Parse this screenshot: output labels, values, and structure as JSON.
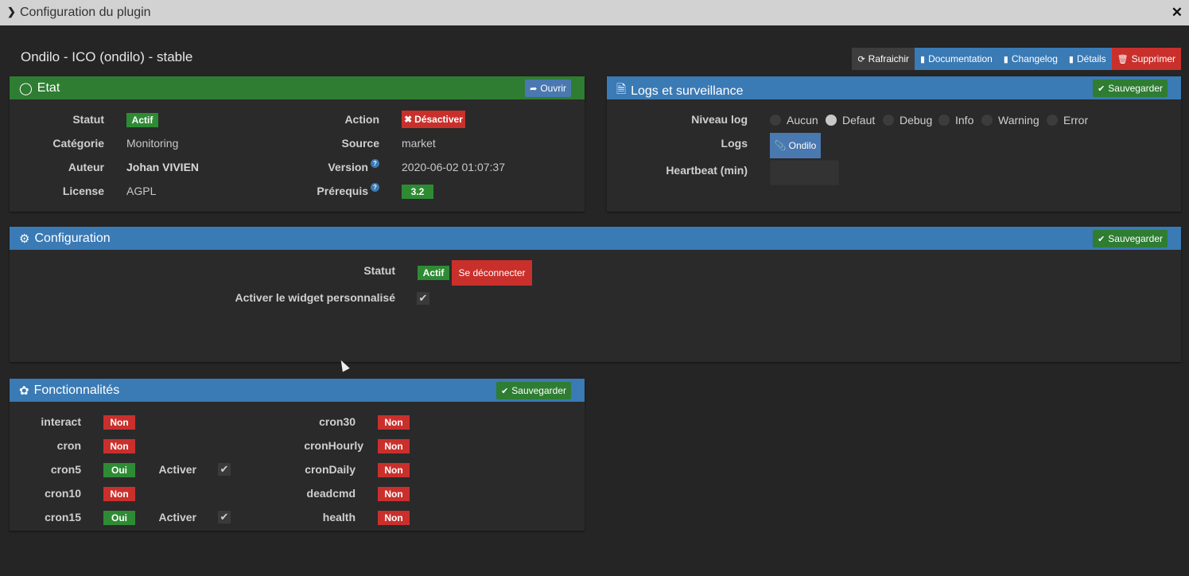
{
  "window": {
    "title": "Configuration du plugin",
    "chevron_icon": "chevron-right-icon",
    "close_icon": "close-icon"
  },
  "plugin_title": "Ondilo - ICO (ondilo) - stable",
  "top_buttons": [
    {
      "label": "Rafraichir",
      "icon": "refresh-icon"
    },
    {
      "label": "Documentation",
      "icon": "book-icon"
    },
    {
      "label": "Changelog",
      "icon": "book-icon"
    },
    {
      "label": "Détails",
      "icon": "book-icon"
    },
    {
      "label": "Supprimer",
      "icon": "trash-icon"
    }
  ],
  "etat": {
    "title": "Etat",
    "open_button": "Ouvrir",
    "statut_label": "Statut",
    "statut_value": "Actif",
    "categorie_label": "Catégorie",
    "categorie_value": "Monitoring",
    "auteur_label": "Auteur",
    "auteur_value": "Johan VIVIEN",
    "license_label": "License",
    "license_value": "AGPL",
    "action_label": "Action",
    "action_button": "Désactiver",
    "source_label": "Source",
    "source_value": "market",
    "version_label": "Version",
    "version_value": "2020-06-02 01:07:37",
    "prerequis_label": "Prérequis",
    "prerequis_value": "3.2"
  },
  "logs": {
    "title": "Logs et surveillance",
    "save_button": "Sauvegarder",
    "niveau_label": "Niveau log",
    "levels": [
      "Aucun",
      "Defaut",
      "Debug",
      "Info",
      "Warning",
      "Error"
    ],
    "selected_level": "Defaut",
    "logs_label": "Logs",
    "logs_button": "Ondilo",
    "heartbeat_label": "Heartbeat (min)",
    "heartbeat_value": ""
  },
  "configuration": {
    "title": "Configuration",
    "save_button": "Sauvegarder",
    "statut_label": "Statut",
    "statut_value": "Actif",
    "disconnect_button": "Se déconnecter",
    "widget_label": "Activer le widget personnalisé",
    "widget_checked": true
  },
  "fonctionnalites": {
    "title": "Fonctionnalités",
    "save_button": "Sauvegarder",
    "activer_label": "Activer",
    "left": [
      {
        "name": "interact",
        "value": "Non"
      },
      {
        "name": "cron",
        "value": "Non"
      },
      {
        "name": "cron5",
        "value": "Oui",
        "activer": true
      },
      {
        "name": "cron10",
        "value": "Non"
      },
      {
        "name": "cron15",
        "value": "Oui",
        "activer": true
      }
    ],
    "right": [
      {
        "name": "cron30",
        "value": "Non"
      },
      {
        "name": "cronHourly",
        "value": "Non"
      },
      {
        "name": "cronDaily",
        "value": "Non"
      },
      {
        "name": "deadcmd",
        "value": "Non"
      },
      {
        "name": "health",
        "value": "Non"
      }
    ]
  },
  "colors": {
    "green": "#2e7d32",
    "blue": "#3a7ab5",
    "red": "#c9302c",
    "background": "#252525"
  }
}
